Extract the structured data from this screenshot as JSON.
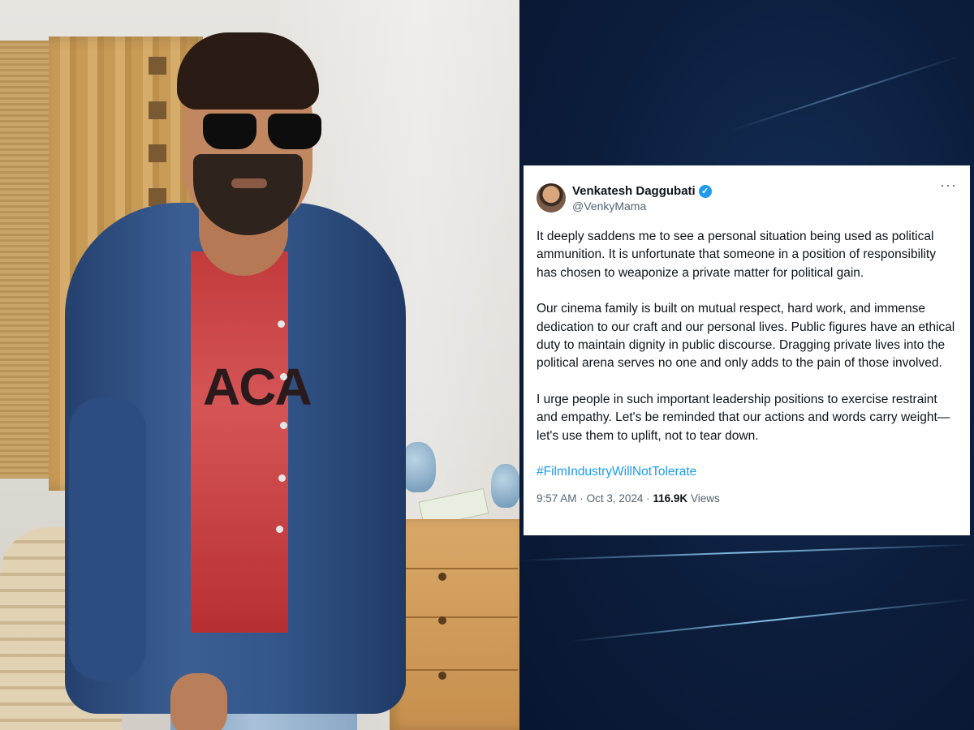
{
  "tweet": {
    "display_name": "Venkatesh Daggubati",
    "handle": "@VenkyMama",
    "more_menu": "···",
    "paragraphs": [
      "It deeply saddens me to see a personal situation being used as political ammunition. It is unfortunate that someone in a position of responsibility has chosen to weaponize a private matter for political gain.",
      "Our cinema family is built on mutual respect, hard work, and immense dedication to our craft and our personal lives. Public figures have an ethical duty to maintain dignity in public discourse. Dragging private lives into the political arena serves no one and only adds to the pain of those involved.",
      "I urge people in such important leadership positions to exercise restraint and empathy. Let's be reminded that our actions and words carry weight—let's use them to uplift, not to tear down."
    ],
    "hashtag": "#FilmIndustryWillNotTolerate",
    "time": "9:57 AM",
    "date": "Oct 3, 2024",
    "separator": "·",
    "views_count": "116.9K",
    "views_label": "Views",
    "verified_mark": "✓"
  },
  "photo": {
    "shirt_text": "ACA"
  },
  "colors": {
    "link": "#1d9bf0",
    "text_primary": "#0f1419",
    "text_secondary": "#536471",
    "background_right": "#0c1d3c"
  }
}
